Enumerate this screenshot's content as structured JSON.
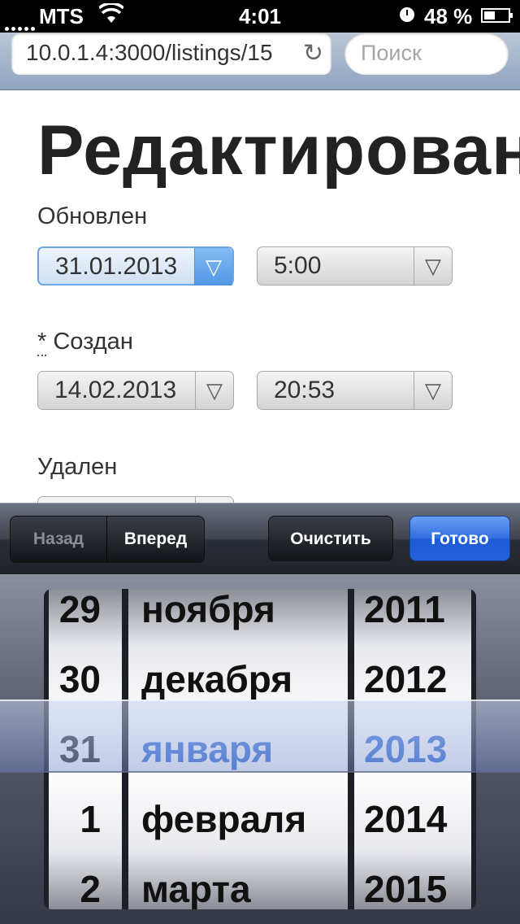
{
  "status_bar": {
    "carrier": "MTS",
    "time": "4:01",
    "battery_percent": "48 %",
    "battery_level": 0.48
  },
  "browser": {
    "url": "10.0.1.4:3000/listings/15",
    "search_placeholder": "Поиск"
  },
  "page": {
    "title": "Редактирование",
    "fields": {
      "updated": {
        "label": "Обновлен",
        "date": "31.01.2013",
        "time": "5:00"
      },
      "created": {
        "required_mark": "*",
        "label": "Создан",
        "date": "14.02.2013",
        "time": "20:53"
      },
      "deleted": {
        "label": "Удален"
      }
    }
  },
  "toolbar": {
    "prev_label": "Назад",
    "next_label": "Вперед",
    "clear_label": "Очистить",
    "done_label": "Готово"
  },
  "picker": {
    "days": [
      "29",
      "30",
      "31",
      "1",
      "2"
    ],
    "months": [
      "ноября",
      "декабря",
      "января",
      "февраля",
      "марта"
    ],
    "years": [
      "2011",
      "2012",
      "2013",
      "2014",
      "2015"
    ],
    "selected_index": 2
  },
  "colors": {
    "accent_blue": "#3b73d8",
    "done_button": "#2262dc",
    "toolbar_dark": "#1f2229"
  }
}
